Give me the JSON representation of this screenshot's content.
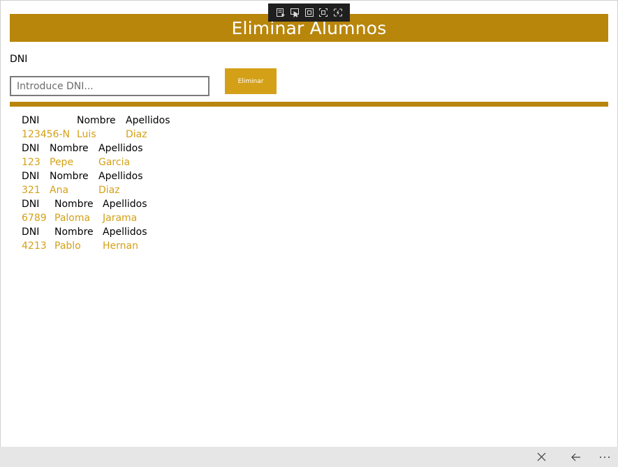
{
  "header": {
    "title": "Eliminar Alumnos"
  },
  "form": {
    "dni_label": "DNI",
    "dni_placeholder": "Introduce DNI...",
    "delete_label": "Eliminar"
  },
  "records": [
    {
      "header": {
        "dni": "DNI",
        "nombre": "Nombre",
        "apellidos": "Apellidos"
      },
      "data": {
        "dni": "123456-N",
        "nombre": "Luis",
        "apellidos": "Diaz"
      }
    },
    {
      "header": {
        "dni": "DNI",
        "nombre": "Nombre",
        "apellidos": "Apellidos"
      },
      "data": {
        "dni": "123",
        "nombre": "Pepe",
        "apellidos": "Garcia"
      }
    },
    {
      "header": {
        "dni": "DNI",
        "nombre": "Nombre",
        "apellidos": "Apellidos"
      },
      "data": {
        "dni": "321",
        "nombre": "Ana",
        "apellidos": "Diaz"
      }
    },
    {
      "header": {
        "dni": "DNI",
        "nombre": "Nombre",
        "apellidos": "Apellidos"
      },
      "data": {
        "dni": "6789",
        "nombre": "Paloma",
        "apellidos": "Jarama"
      }
    },
    {
      "header": {
        "dni": "DNI",
        "nombre": "Nombre",
        "apellidos": "Apellidos"
      },
      "data": {
        "dni": "4213",
        "nombre": "Pablo",
        "apellidos": "Hernan"
      }
    }
  ],
  "colors": {
    "accent": "#b8860b",
    "button": "#d4a017",
    "data_text": "#d4a017"
  },
  "icons": {
    "debug_toolbar": [
      "live-visual-tree-icon",
      "select-element-icon",
      "display-layout-adorners-icon",
      "track-focus-icon",
      "xaml-hot-reload-icon"
    ],
    "bottom_bar": [
      "close-icon",
      "back-arrow-icon",
      "more-icon"
    ]
  }
}
